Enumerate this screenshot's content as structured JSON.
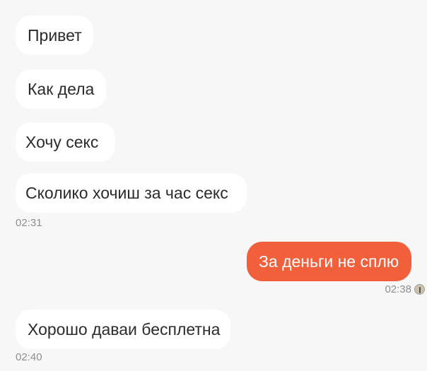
{
  "messages": [
    {
      "direction": "in",
      "text": "Привет"
    },
    {
      "direction": "in",
      "text": "Как дела"
    },
    {
      "direction": "in",
      "text": " Хочу секс"
    },
    {
      "direction": "in",
      "text": " Сколико хочиш за час секс",
      "time": "02:31"
    },
    {
      "direction": "out",
      "text": "За деньги не сплю",
      "time": "02:38",
      "status_icon": "read-avatar-icon"
    },
    {
      "direction": "in",
      "text": "Хорошо даваи бесплетна",
      "time": "02:40"
    }
  ],
  "colors": {
    "background": "#f7f7f7",
    "incoming_bubble": "#ffffff",
    "outgoing_bubble": "#f2603b",
    "timestamp": "#8e8e8e"
  }
}
